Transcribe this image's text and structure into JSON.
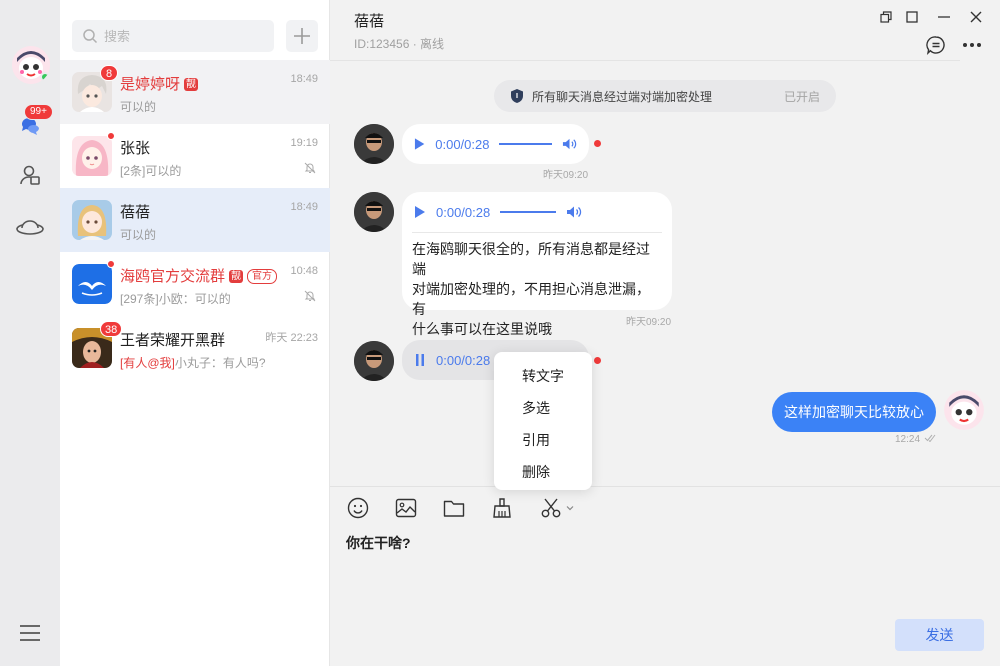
{
  "rail": {
    "unread_badge": "99+",
    "colors": {
      "online": "#35c759",
      "badge": "#f03a3a"
    }
  },
  "list": {
    "search": {
      "placeholder": "搜索"
    },
    "conversations": [
      {
        "name": "是婷婷呀",
        "tag": "靓",
        "time": "18:49",
        "preview": "可以的",
        "badge": "8",
        "avatar": "anime-boy-avatar"
      },
      {
        "name": "张张",
        "time": "19:19",
        "preview": "[2条]可以的",
        "muted": true,
        "avatar": "anime-girl-pink-avatar"
      },
      {
        "name": "蓓蓓",
        "time": "18:49",
        "preview": "可以的",
        "avatar": "anime-girl-blonde-avatar"
      },
      {
        "name": "海鸥官方交流群",
        "tag": "靓",
        "tag2": "官方",
        "time": "10:48",
        "preview": "[297条]小欧：可以的",
        "muted": true,
        "avatar": "seagull-logo-avatar"
      },
      {
        "name": "王者荣耀开黑群",
        "time": "昨天 22:23",
        "preview_at": "[有人@我]",
        "preview": "小丸子：有人吗?",
        "badge": "38",
        "avatar": "game-hero-avatar"
      }
    ]
  },
  "chat": {
    "title": "蓓蓓",
    "subtitle": "ID:123456 · 离线",
    "notice": {
      "text": "所有聊天消息经过端对端加密处理",
      "status": "已开启"
    },
    "messages": [
      {
        "type": "voice",
        "duration": "0:00/0:28",
        "time": "昨天09:20"
      },
      {
        "type": "voice",
        "duration": "0:00/0:28",
        "text_lines": [
          "在海鸥聊天很全的，所有消息都是经过端",
          "对端加密处理的，不用担心消息泄漏，有",
          "什么事可以在这里说哦"
        ],
        "time": "昨天09:20"
      },
      {
        "type": "voice",
        "duration": "0:00/0:28",
        "playing": true
      },
      {
        "type": "outgoing",
        "text": "这样加密聊天比较放心",
        "time": "12:24"
      }
    ],
    "context_menu": [
      "转文字",
      "多选",
      "引用",
      "删除"
    ],
    "composer": {
      "draft": "你在干啥?",
      "send_label": "发送"
    }
  }
}
